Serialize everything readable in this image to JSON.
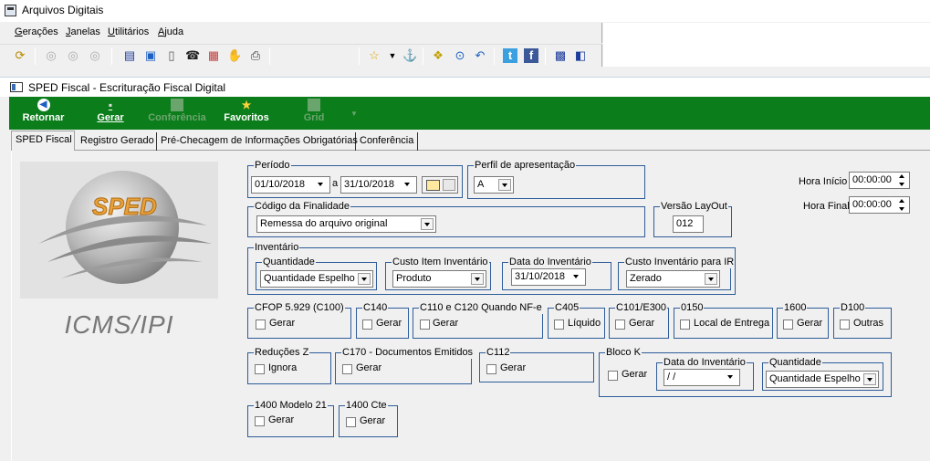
{
  "window": {
    "title": "Arquivos Digitais"
  },
  "menu": [
    {
      "label": "Gerações",
      "u": "G",
      "rest": "erações"
    },
    {
      "label": "Janelas",
      "u": "J",
      "rest": "anelas"
    },
    {
      "label": "Utilitários",
      "u": "U",
      "rest": "tilitários"
    },
    {
      "label": "Ajuda",
      "u": "A",
      "rest": "juda"
    }
  ],
  "toolbar_icons": [
    "refresh-icon",
    "disc-icon",
    "disc-icon",
    "disc-icon",
    "calendar-icon",
    "window-icon",
    "document-icon",
    "phone-icon",
    "calc-icon",
    "hand-icon",
    "printer-icon",
    "star-icon",
    "dropdown-icon",
    "info-icon",
    "folders-icon",
    "settings-icon",
    "arrow-icon",
    "twitter-icon",
    "facebook-icon",
    "monitor-icon",
    "exit-icon"
  ],
  "inner_window": {
    "title": "SPED Fiscal - Escrituração Fiscal Digital"
  },
  "green_toolbar": {
    "retornar": "Retornar",
    "gerar": "Gerar",
    "conferencia": "Conferência",
    "favoritos": "Favoritos",
    "grid": "Grid"
  },
  "tabs": [
    "SPED Fiscal",
    "Registro Gerado",
    "Pré-Checagem de Informações Obrigatórias",
    "Conferência"
  ],
  "logo": {
    "badge": "SPED",
    "caption": "ICMS/IPI"
  },
  "periodo": {
    "legend": "Período",
    "start": "01/10/2018",
    "sep": "a",
    "end": "31/10/2018"
  },
  "perfil": {
    "legend": "Perfil de apresentação",
    "value": "A"
  },
  "hora": {
    "inicio_label": "Hora Início",
    "inicio": "00:00:00",
    "final_label": "Hora Final",
    "final": "00:00:00"
  },
  "finalidade": {
    "legend": "Código da Finalidade",
    "value": "Remessa do arquivo original"
  },
  "versao": {
    "legend": "Versão LayOut",
    "value": "012"
  },
  "inventario": {
    "legend": "Inventário",
    "quantidade_legend": "Quantidade",
    "quantidade": "Quantidade Espelho",
    "custo_legend": "Custo Item Inventário",
    "custo": "Produto",
    "data_legend": "Data do Inventário",
    "data": "31/10/2018",
    "custo_ir_legend": "Custo Inventário para IR",
    "custo_ir": "Zerado"
  },
  "row1": [
    {
      "legend": "CFOP 5.929 (C100)",
      "label": "Gerar"
    },
    {
      "legend": "C140",
      "label": "Gerar"
    },
    {
      "legend": "C110 e C120 Quando NF-e",
      "label": "Gerar"
    },
    {
      "legend": "C405",
      "label": "Líquido"
    },
    {
      "legend": "C101/E300",
      "label": "Gerar"
    },
    {
      "legend": "0150",
      "label": "Local de Entrega"
    },
    {
      "legend": "1600",
      "label": "Gerar"
    },
    {
      "legend": "D100",
      "label": "Outras"
    }
  ],
  "row2": [
    {
      "legend": "Reduções Z",
      "label": "Ignora"
    },
    {
      "legend": "C170 - Documentos Emitidos",
      "label": "Gerar"
    },
    {
      "legend": "C112",
      "label": "Gerar"
    }
  ],
  "blocok": {
    "legend": "Bloco K",
    "label": "Gerar",
    "data_legend": "Data do Inventário",
    "data": " /  /",
    "quantidade_legend": "Quantidade",
    "quantidade": "Quantidade Espelho"
  },
  "row3": [
    {
      "legend": "1400 Modelo 21",
      "label": "Gerar"
    },
    {
      "legend": "1400 Cte",
      "label": "Gerar"
    }
  ]
}
